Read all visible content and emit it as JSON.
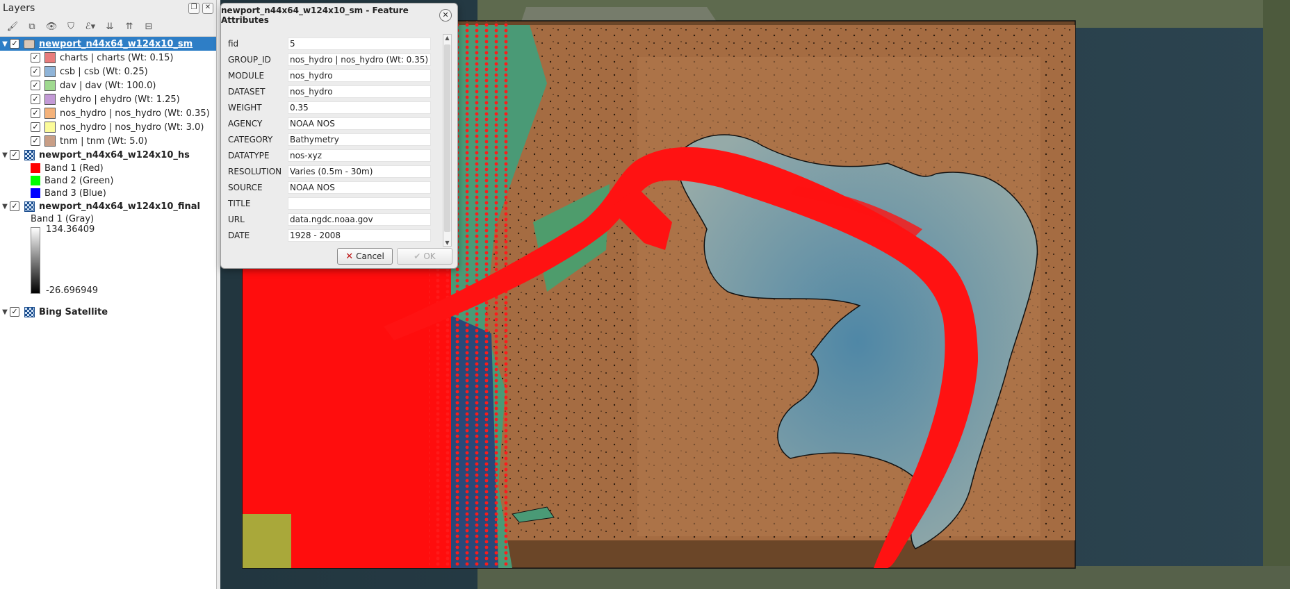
{
  "layers_panel": {
    "title": "Layers",
    "toolbar_icons": [
      "style-brush-icon",
      "add-group-icon",
      "visibility-eye-icon",
      "filter-icon",
      "filter-expression-icon",
      "expand-all-icon",
      "collapse-all-icon",
      "remove-layer-icon"
    ],
    "layers": [
      {
        "name": "newport_n44x64_w124x10_sm",
        "type": "vector",
        "selected": true,
        "items": [
          {
            "label": "charts | charts (Wt: 0.15)",
            "color": "#e87c7c"
          },
          {
            "label": "csb | csb (Wt: 0.25)",
            "color": "#8fb4d8"
          },
          {
            "label": "dav | dav (Wt: 100.0)",
            "color": "#9fd98f"
          },
          {
            "label": "ehydro | ehydro (Wt: 1.25)",
            "color": "#c39ad6"
          },
          {
            "label": "nos_hydro | nos_hydro (Wt: 0.35)",
            "color": "#f4b27a"
          },
          {
            "label": "nos_hydro | nos_hydro (Wt: 3.0)",
            "color": "#fbfb9a"
          },
          {
            "label": "tnm | tnm (Wt: 5.0)",
            "color": "#c89e86"
          }
        ]
      },
      {
        "name": "newport_n44x64_w124x10_hs",
        "type": "raster",
        "bands": [
          {
            "label": "Band 1 (Red)",
            "color": "#ff0000"
          },
          {
            "label": "Band 2 (Green)",
            "color": "#00ff00"
          },
          {
            "label": "Band 3 (Blue)",
            "color": "#0000ff"
          }
        ]
      },
      {
        "name": "newport_n44x64_w124x10_final",
        "type": "raster",
        "band_label": "Band 1 (Gray)",
        "max_value": "134.36409",
        "min_value": "-26.696949"
      },
      {
        "name": "Bing Satellite",
        "type": "raster"
      }
    ]
  },
  "dialog": {
    "title": "newport_n44x64_w124x10_sm - Feature Attributes",
    "attributes": [
      {
        "key": "fid",
        "value": "5"
      },
      {
        "key": "GROUP_ID",
        "value": "nos_hydro | nos_hydro (Wt: 0.35)"
      },
      {
        "key": "MODULE",
        "value": "nos_hydro"
      },
      {
        "key": "DATASET",
        "value": "nos_hydro"
      },
      {
        "key": "WEIGHT",
        "value": "0.35"
      },
      {
        "key": "AGENCY",
        "value": "NOAA NOS"
      },
      {
        "key": "CATEGORY",
        "value": "Bathymetry"
      },
      {
        "key": "DATATYPE",
        "value": "nos-xyz"
      },
      {
        "key": "RESOLUTION",
        "value": "Varies (0.5m - 30m)"
      },
      {
        "key": "SOURCE",
        "value": "NOAA NOS"
      },
      {
        "key": "TITLE",
        "value": ""
      },
      {
        "key": "URL",
        "value": "data.ngdc.noaa.gov"
      },
      {
        "key": "DATE",
        "value": "1928 - 2008"
      }
    ],
    "cancel_label": "Cancel",
    "ok_label": "OK"
  }
}
